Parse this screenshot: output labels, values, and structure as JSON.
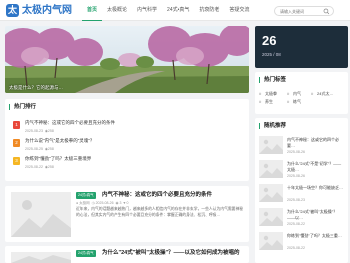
{
  "site": {
    "logo_char": "太",
    "name": "太极内气网"
  },
  "nav": [
    "首页",
    "太极概论",
    "内气科学",
    "24式•真气",
    "抗衰防老",
    "答疑交流"
  ],
  "search": {
    "placeholder": "请输入关键词"
  },
  "hero": {
    "caption": "太极是什么？它的起源与…"
  },
  "date": {
    "day": "26",
    "month_year": "2025 / 08"
  },
  "hot_tags": {
    "title": "热门标签",
    "tags": [
      "太极拳",
      "内气",
      "24式太…",
      "养生",
      "练气"
    ]
  },
  "ranking": {
    "title": "热门排行",
    "items": [
      {
        "num": "1",
        "title": "内气不神秘：这或它的四个必要且充分的条件",
        "date": "2025-08-23",
        "views": "258"
      },
      {
        "num": "2",
        "title": "为什么说\"内气\"是太极拳的\"灵魂\"？",
        "date": "2025-08-25",
        "views": "258"
      },
      {
        "num": "3",
        "title": "你练到\"懂劲\"了吗？太极三重境界",
        "date": "2025-08-22",
        "views": "258"
      }
    ]
  },
  "recommend": {
    "title": "随机推荐",
    "items": [
      {
        "title": "内气不神秘：这或它的四个必要…",
        "date": "2025-08-26"
      },
      {
        "title": "为什么\"24式\"不是\"初学\"？——太极…",
        "date": "2025-08-26"
      },
      {
        "title": "十年太极一场空？你可能缺乏…",
        "date": "2025-08-23"
      },
      {
        "title": "为什么\"24式\"被叫\"太极操\"？——以…",
        "date": "2025-08-22"
      },
      {
        "title": "你练到\"懂劲\"了吗？太极三重…",
        "date": "2025-08-22"
      }
    ]
  },
  "articles": [
    {
      "tag": "24式•真气",
      "title": "内气不神秘：这或它的四个必要且充分的条件",
      "author": "太极网",
      "date": "2025-08-26",
      "views": "3",
      "likes": "0",
      "excerpt": "近年来，内气的话题越来越热门，越来越多的人相信内气的存在并非玄学，一些人认为内气需要神秘的心法，但其实内气的产生有四个必要且充分的条件：掌握正确的身法、松沉、呼吸…"
    },
    {
      "tag": "24式•真气",
      "title": "为什么\"24式\"被叫\"太极操\"？——以及它如何成为被唱的",
      "author": "",
      "date": "",
      "views": "",
      "likes": "",
      "excerpt": ""
    }
  ],
  "colors": {
    "accent": "#23a26d",
    "brand": "#2f76c7",
    "rank1": "#e8473a",
    "rank2": "#f08a24",
    "rank3": "#f5b623",
    "dark": "#1d2d3a"
  }
}
